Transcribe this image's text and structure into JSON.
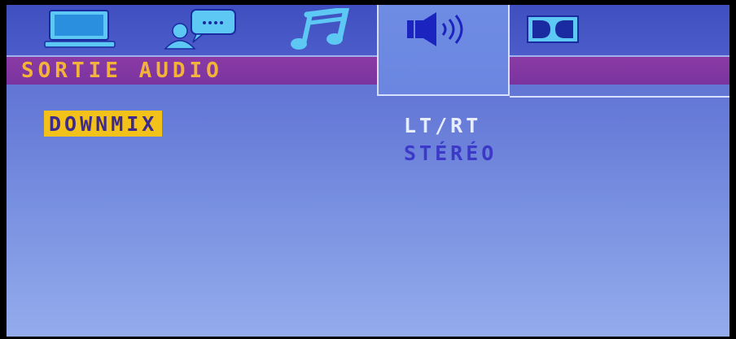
{
  "menu": {
    "tabs": [
      {
        "icon": "monitor-icon"
      },
      {
        "icon": "speech-bubble-person-icon"
      },
      {
        "icon": "music-note-icon"
      },
      {
        "icon": "speaker-icon",
        "active": true
      },
      {
        "icon": "dolby-icon"
      }
    ],
    "title": "SORTIE AUDIO",
    "option_label": "DOWNMIX",
    "options": [
      "LT/RT",
      "STÉRÉO"
    ],
    "selected_option": "LT/RT"
  },
  "colors": {
    "background": "#6478d6",
    "title_bar": "#7a34a0",
    "title_text": "#f3b33a",
    "highlight": "#f2c21a",
    "selected_value": "#e8ecff",
    "unselected_value": "#3c38c8"
  }
}
